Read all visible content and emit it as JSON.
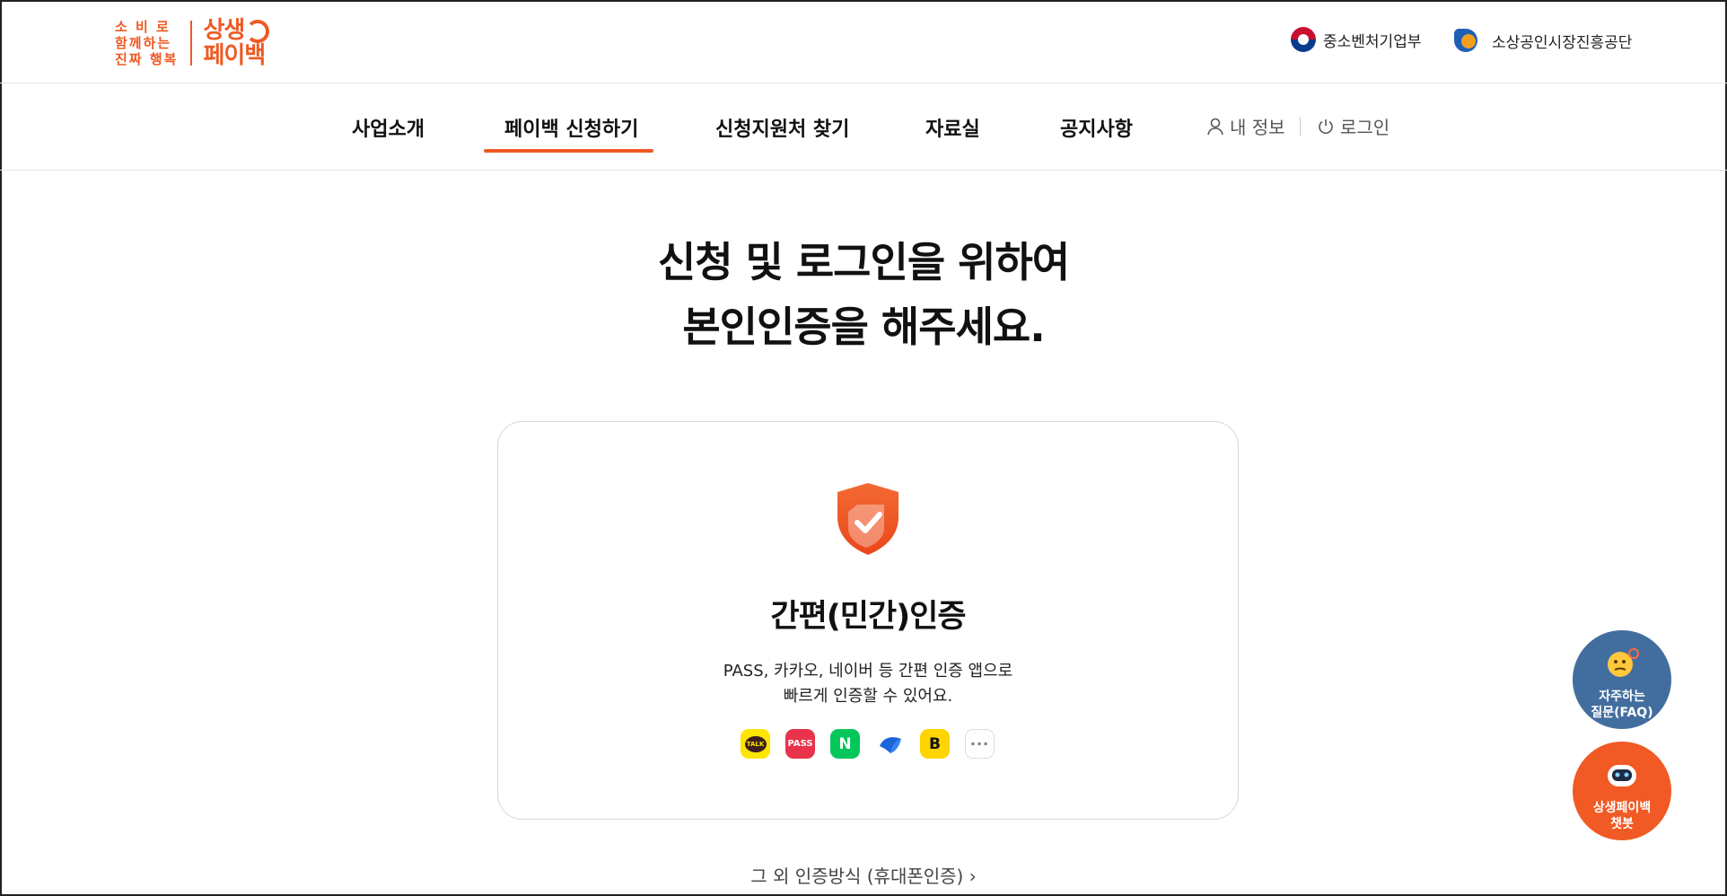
{
  "header": {
    "logo_small_lines": [
      "소 비 로",
      "함께하는",
      "진짜 행복"
    ],
    "logo_big_lines": [
      "상생",
      "페이백"
    ],
    "org1": "중소벤처기업부",
    "org2": "소상공인시장진흥공단"
  },
  "nav": {
    "items": [
      "사업소개",
      "페이백 신청하기",
      "신청지원처 찾기",
      "자료실",
      "공지사항"
    ],
    "active_index": 1,
    "my_info": "내 정보",
    "login": "로그인"
  },
  "headline": {
    "line1": "신청 및 로그인을 위하여",
    "line2": "본인인증을 해주세요."
  },
  "card": {
    "title": "간편(민간)인증",
    "desc_line1": "PASS, 카카오, 네이버 등 간편 인증 앱으로",
    "desc_line2": "빠르게 인증할 수 있어요.",
    "apps": [
      {
        "name": "kakao-talk-icon",
        "label": "TALK"
      },
      {
        "name": "pass-icon",
        "label": "PASS"
      },
      {
        "name": "naver-icon",
        "label": "N"
      },
      {
        "name": "toss-icon",
        "label": ""
      },
      {
        "name": "banksalad-icon",
        "label": "B"
      },
      {
        "name": "more-icon",
        "label": "···"
      }
    ]
  },
  "other_methods": "그 외 인증방식 (휴대폰인증) ›",
  "floating": {
    "faq_line1": "자주하는",
    "faq_line2": "질문(FAQ)",
    "bot_line1": "상생페이백",
    "bot_line2": "챗봇"
  },
  "colors": {
    "accent": "#ee5a24",
    "faq_bg": "#426e9f",
    "bot_bg": "#f15a24"
  }
}
